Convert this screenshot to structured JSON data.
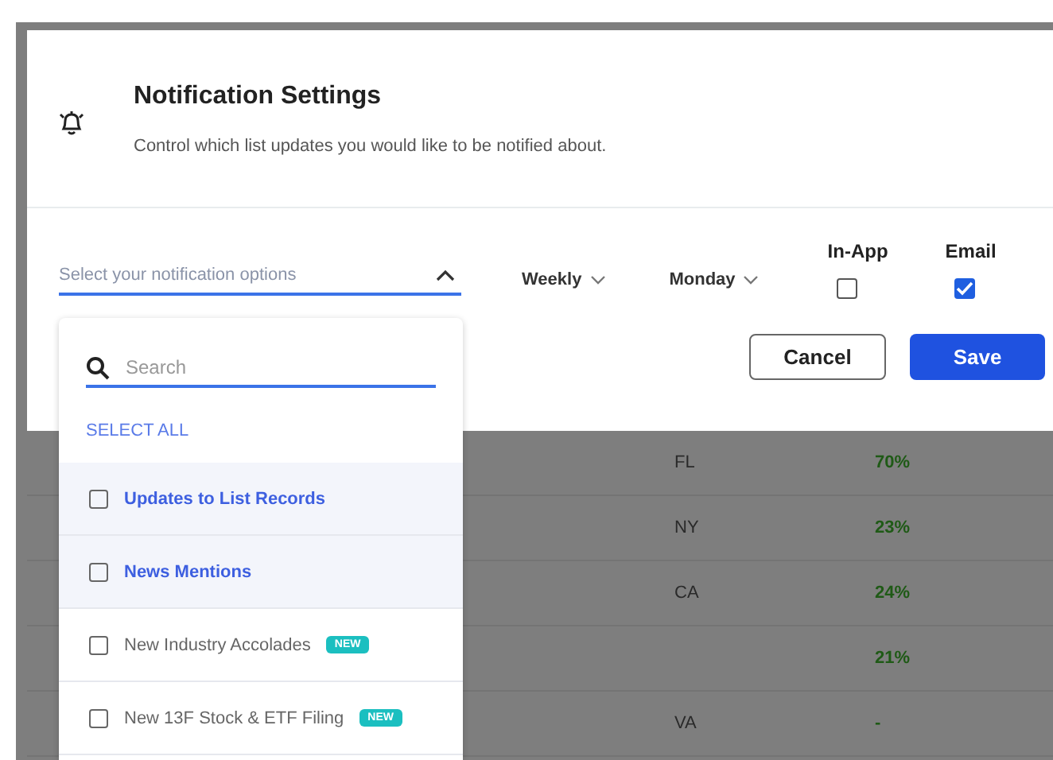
{
  "modal": {
    "title": "Notification Settings",
    "subtitle": "Control which list updates you would like to be notified about.",
    "select": {
      "placeholder": "Select your notification options",
      "expanded": true
    },
    "frequency": "Weekly",
    "day": "Monday",
    "channels": [
      {
        "label": "In-App",
        "checked": false
      },
      {
        "label": "Email",
        "checked": true
      }
    ],
    "buttons": {
      "cancel": "Cancel",
      "save": "Save"
    }
  },
  "dropdown": {
    "search": {
      "placeholder": "Search"
    },
    "select_all": "SELECT ALL",
    "options": [
      {
        "label": "Updates to List Records",
        "checked": false,
        "highlighted": true
      },
      {
        "label": "News Mentions",
        "checked": false,
        "highlighted": true
      },
      {
        "label": "New Industry Accolades",
        "checked": false,
        "highlighted": false,
        "badge": "NEW"
      },
      {
        "label": "New 13F Stock & ETF Filing",
        "checked": false,
        "highlighted": false,
        "badge": "NEW"
      }
    ]
  },
  "table": {
    "rows": [
      {
        "column_1": "FL",
        "column_2": "70%"
      },
      {
        "column_1": "NY",
        "column_2": "23%"
      },
      {
        "column_1": "CA",
        "column_2": "24%"
      },
      {
        "column_2": "21%"
      },
      {
        "column_1": "VA",
        "column_2": "-"
      }
    ]
  }
}
